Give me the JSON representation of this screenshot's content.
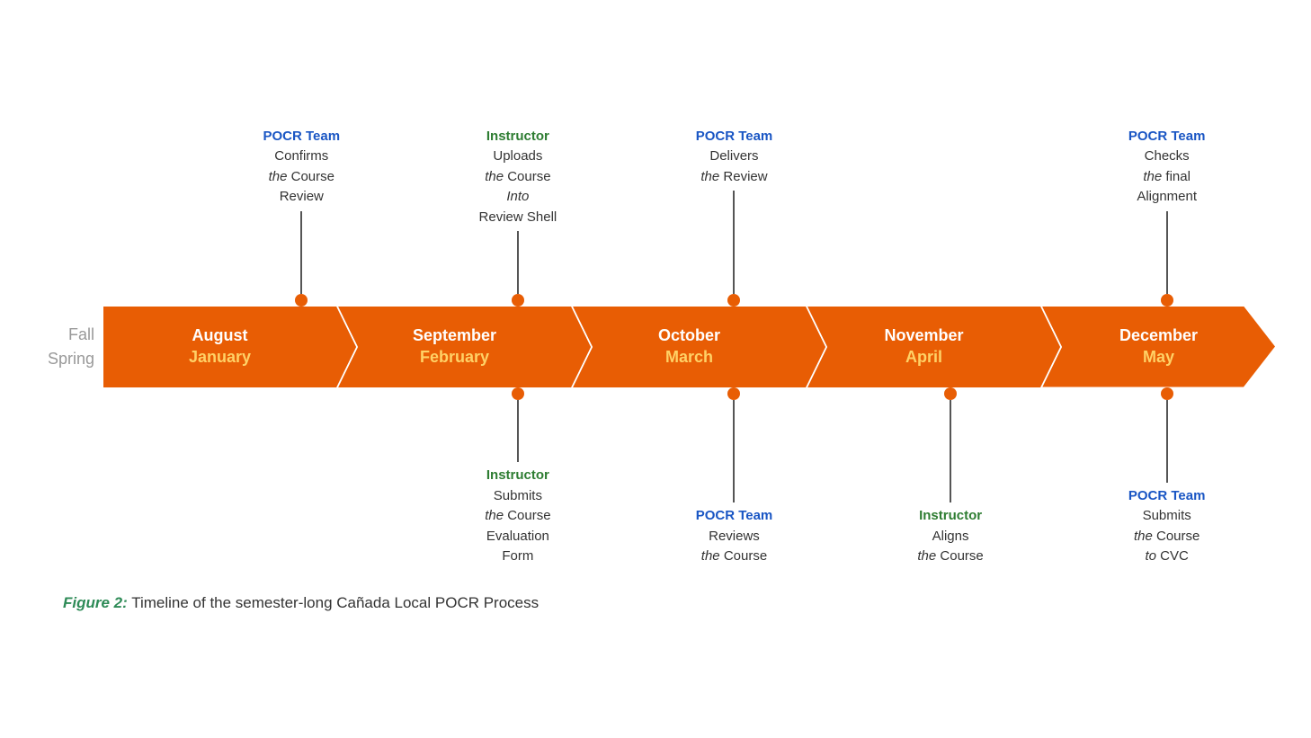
{
  "seasons": {
    "fall": "Fall",
    "spring": "Spring"
  },
  "segments": [
    {
      "id": "aug-jan",
      "month_fall": "August",
      "month_spring": "January",
      "top_annotation": {
        "actor": "POCR Team",
        "lines": [
          "Confirms",
          "the Course",
          "Review"
        ]
      },
      "bottom_annotation": null
    },
    {
      "id": "sep-feb",
      "month_fall": "September",
      "month_spring": "February",
      "top_annotation": {
        "actor": "Instructor",
        "lines": [
          "Uploads",
          "the Course",
          "Into",
          "Review Shell"
        ]
      },
      "bottom_annotation": {
        "actor": "Instructor",
        "lines": [
          "Submits",
          "the Course",
          "Evaluation",
          "Form"
        ]
      }
    },
    {
      "id": "oct-mar",
      "month_fall": "October",
      "month_spring": "March",
      "top_annotation": {
        "actor": "POCR Team",
        "lines": [
          "Delivers",
          "the Review"
        ]
      },
      "bottom_annotation": {
        "actor": "POCR Team",
        "lines": [
          "Reviews",
          "the Course"
        ]
      }
    },
    {
      "id": "nov-apr",
      "month_fall": "November",
      "month_spring": "April",
      "top_annotation": null,
      "bottom_annotation": {
        "actor": "Instructor",
        "lines": [
          "Aligns",
          "the Course"
        ]
      }
    },
    {
      "id": "dec-may",
      "month_fall": "December",
      "month_spring": "May",
      "top_annotation": {
        "actor": "POCR Team",
        "lines": [
          "Checks",
          "the final",
          "Alignment"
        ]
      },
      "bottom_annotation": {
        "actor": "POCR Team",
        "lines": [
          "Submits",
          "the Course",
          "to CVC"
        ]
      }
    }
  ],
  "figure_caption": {
    "label": "Figure 2:",
    "text": " Timeline of the semester-long Cañada Local POCR Process"
  },
  "colors": {
    "orange": "#e85d04",
    "blue_actor": "#1a56c4",
    "green_actor": "#2e7d32",
    "spring_month": "#ffd166",
    "gray_season": "#999",
    "connector": "#555",
    "fig_label": "#2e8b57"
  }
}
